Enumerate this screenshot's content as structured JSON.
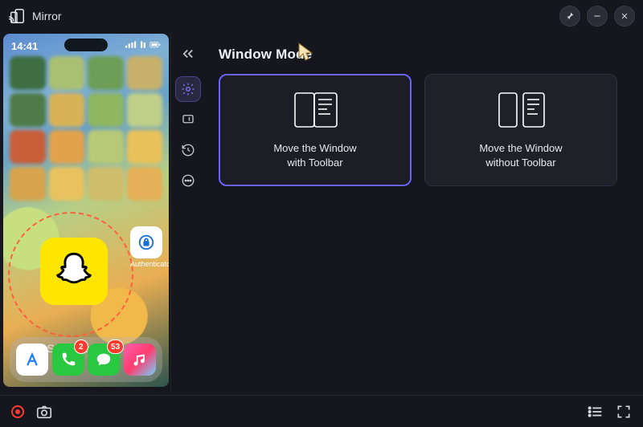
{
  "app": {
    "title": "Mirror"
  },
  "windowButtons": {
    "pin": "📌",
    "min": "—",
    "close": "✕"
  },
  "phone": {
    "time": "14:41",
    "snapchatLabel": "Snapchat",
    "authLabel": "Authenticator",
    "dockBadges": {
      "phone": "2",
      "messages": "53"
    }
  },
  "sidebar": {
    "collapse": "«",
    "items": [
      "settings",
      "screen",
      "history",
      "more"
    ]
  },
  "content": {
    "heading": "Window Mode",
    "cards": [
      {
        "label_l1": "Move the Window",
        "label_l2": "with Toolbar",
        "selected": true
      },
      {
        "label_l1": "Move the Window",
        "label_l2": "without Toolbar",
        "selected": false
      }
    ]
  },
  "bottom": {
    "record": "rec",
    "screenshot": "camera",
    "list": "list",
    "fullscreen": "fullscreen"
  }
}
